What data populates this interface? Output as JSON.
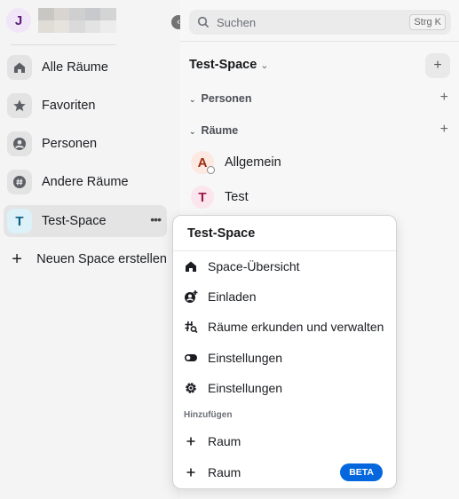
{
  "user": {
    "initial": "J"
  },
  "spaces": [
    {
      "label": "Alle Räume",
      "icon": "home-icon"
    },
    {
      "label": "Favoriten",
      "icon": "star-icon"
    },
    {
      "label": "Personen",
      "icon": "person-icon"
    },
    {
      "label": "Andere Räume",
      "icon": "hash-icon"
    },
    {
      "label": "Test-Space",
      "icon": "letter",
      "letter": "T",
      "active": true
    },
    {
      "label": "Neuen Space erstellen",
      "icon": "plus-icon"
    }
  ],
  "search": {
    "label": "Suchen",
    "shortcut": "Strg K"
  },
  "room_list": {
    "space_title": "Test-Space",
    "sections": [
      {
        "label": "Personen"
      },
      {
        "label": "Räume"
      }
    ],
    "rooms": [
      {
        "name": "Allgemein",
        "letter": "A"
      },
      {
        "name": "Test",
        "letter": "T"
      }
    ]
  },
  "context_menu": {
    "title": "Test-Space",
    "items": [
      {
        "label": "Space-Übersicht",
        "icon": "home-icon"
      },
      {
        "label": "Einladen",
        "icon": "invite-icon"
      },
      {
        "label": "Räume erkunden und verwalten",
        "icon": "explore-rooms-icon"
      },
      {
        "label": "Einstellungen",
        "icon": "toggle-icon"
      },
      {
        "label": "Einstellungen",
        "icon": "gear-icon"
      }
    ],
    "add_group": {
      "label": "Hinzufügen",
      "items": [
        {
          "label": "Raum",
          "icon": "plus-icon"
        },
        {
          "label": "Raum",
          "icon": "plus-icon",
          "badge": "BETA"
        }
      ]
    }
  },
  "colors": {
    "accent": "#0467dd",
    "space_bg": "#f4f4f4",
    "roomlist_bg": "#f7f7f7"
  }
}
